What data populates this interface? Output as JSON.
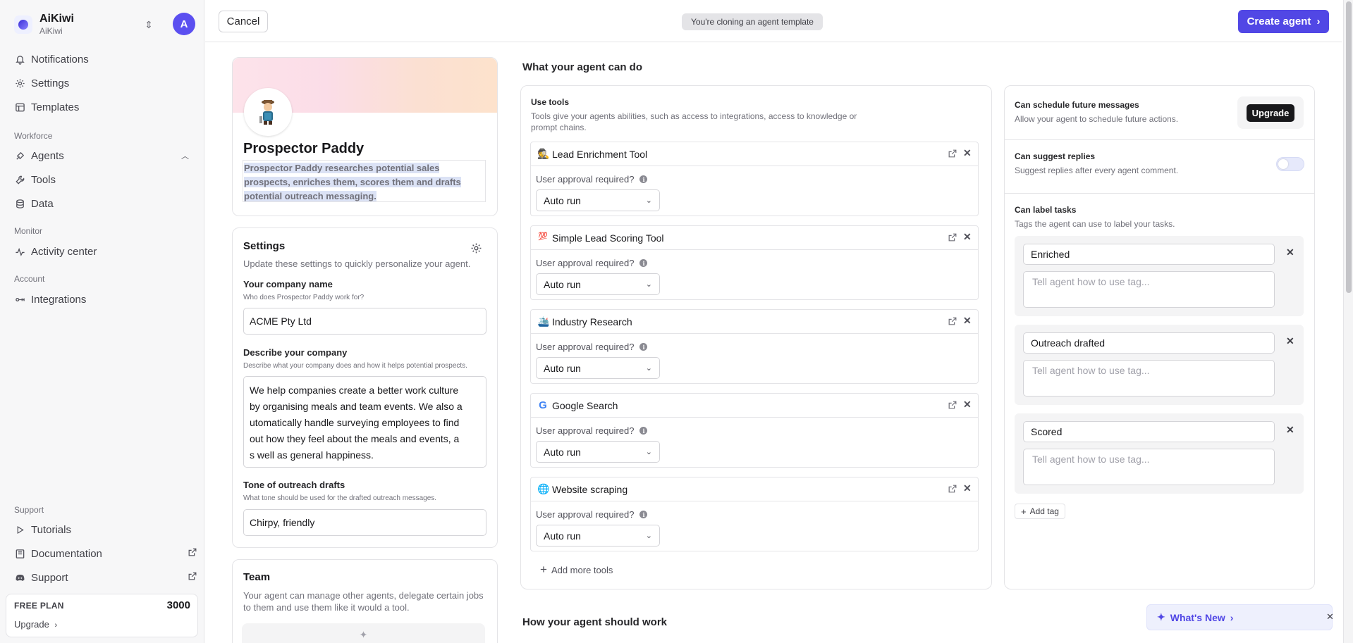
{
  "sidebar": {
    "app_name": "AiKiwi",
    "workspace": "AiKiwi",
    "avatar_initial": "A",
    "items": [
      {
        "label": "Notifications",
        "icon": "bell-icon"
      },
      {
        "label": "Settings",
        "icon": "gear-icon"
      },
      {
        "label": "Templates",
        "icon": "templates-icon"
      }
    ],
    "workforce_label": "Workforce",
    "workforce_items": [
      {
        "label": "Agents",
        "icon": "agents-icon"
      },
      {
        "label": "Tools",
        "icon": "tools-icon"
      },
      {
        "label": "Data",
        "icon": "database-icon"
      }
    ],
    "monitor_label": "Monitor",
    "monitor_items": [
      {
        "label": "Activity center",
        "icon": "activity-icon"
      }
    ],
    "account_label": "Account",
    "account_items": [
      {
        "label": "Integrations",
        "icon": "integrations-icon"
      }
    ],
    "support_label": "Support",
    "support_items": [
      {
        "label": "Tutorials",
        "icon": "play-icon"
      },
      {
        "label": "Documentation",
        "icon": "book-icon"
      },
      {
        "label": "Support",
        "icon": "discord-icon"
      }
    ],
    "plan": {
      "label": "FREE PLAN",
      "credits": "3000",
      "upgrade": "Upgrade"
    }
  },
  "topbar": {
    "cancel": "Cancel",
    "badge": "You're cloning an agent template",
    "create": "Create agent"
  },
  "agent": {
    "name": "Prospector Paddy",
    "description": "Prospector Paddy researches potential sales prospects, enriches them, scores them and drafts potential outreach messaging."
  },
  "settings": {
    "title": "Settings",
    "subtitle": "Update these settings to quickly personalize your agent.",
    "company_name_label": "Your company name",
    "company_name_hint": "Who does Prospector Paddy work for?",
    "company_name_value": "ACME Pty Ltd",
    "describe_label": "Describe your company",
    "describe_hint": "Describe what your company does and how it helps potential prospects.",
    "describe_value": "We help companies create a better work culture\nby organising meals and team events. We also a\nutomatically handle surveying employees to find\nout how they feel about the meals and events, a\ns well as general happiness.",
    "tone_label": "Tone of outreach drafts",
    "tone_hint": "What tone should be used for the drafted outreach messages.",
    "tone_value": "Chirpy, friendly"
  },
  "team": {
    "title": "Team",
    "subtitle": "Your agent can manage other agents, delegate certain jobs to them and use them like it would a tool."
  },
  "main": {
    "can_do_heading": "What your agent can do",
    "how_heading": "How your agent should work"
  },
  "tools": {
    "title": "Use tools",
    "subtitle": "Tools give your agents abilities, such as access to integrations, access to knowledge or prompt chains.",
    "approval_label": "User approval required?",
    "items": [
      {
        "name": "Lead Enrichment Tool",
        "emoji": "🕵️",
        "mode": "Auto run"
      },
      {
        "name": "Simple Lead Scoring Tool",
        "emoji": "💯",
        "mode": "Auto run"
      },
      {
        "name": "Industry Research",
        "emoji": "🛳️",
        "mode": "Auto run"
      },
      {
        "name": "Google Search",
        "emoji": "G",
        "mode": "Auto run"
      },
      {
        "name": "Website scraping",
        "emoji": "🌐",
        "mode": "Auto run"
      }
    ],
    "add_more": "Add more tools"
  },
  "capabilities": {
    "schedule_title": "Can schedule future messages",
    "schedule_sub": "Allow your agent to schedule future actions.",
    "upgrade": "Upgrade",
    "suggest_title": "Can suggest replies",
    "suggest_sub": "Suggest replies after every agent comment.",
    "suggest_enabled": false,
    "label_title": "Can label tasks",
    "label_sub": "Tags the agent can use to label your tasks.",
    "tags": [
      {
        "name": "Enriched",
        "placeholder": "Tell agent how to use tag..."
      },
      {
        "name": "Outreach drafted",
        "placeholder": "Tell agent how to use tag..."
      },
      {
        "name": "Scored",
        "placeholder": "Tell agent how to use tag..."
      }
    ],
    "add_tag": "Add tag"
  },
  "whats_new": {
    "label": "What's New"
  },
  "colors": {
    "accent": "#5147e5",
    "sidebar_bg": "#f7f7f8"
  }
}
